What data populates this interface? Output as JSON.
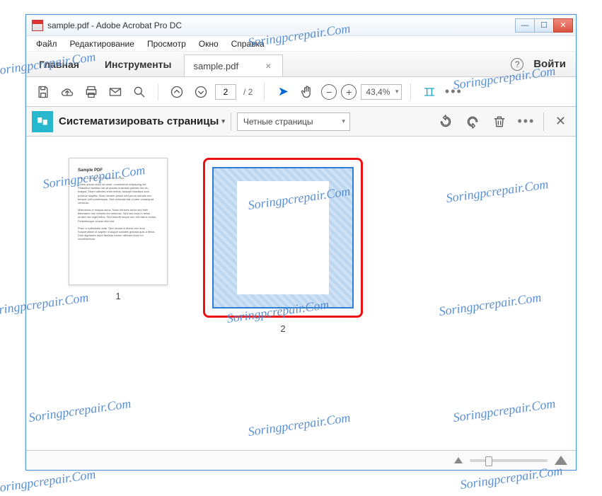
{
  "window": {
    "title": "sample.pdf - Adobe Acrobat Pro DC"
  },
  "menu": {
    "file": "Файл",
    "edit": "Редактирование",
    "view": "Просмотр",
    "window": "Окно",
    "help": "Справка"
  },
  "tabs": {
    "home": "Главная",
    "tools": "Инструменты",
    "doc": "sample.pdf",
    "login": "Войти"
  },
  "toolbar": {
    "page_current": "2",
    "page_total": "/  2",
    "zoom": "43,4%"
  },
  "organize": {
    "title": "Систематизировать страницы",
    "filter": "Четные страницы"
  },
  "pages": [
    {
      "num": "1",
      "heading": "Sample PDF",
      "sub": "This is a simple PDF file. Fun fun fun."
    },
    {
      "num": "2"
    }
  ],
  "watermark": "Soringpcrepair.Com"
}
